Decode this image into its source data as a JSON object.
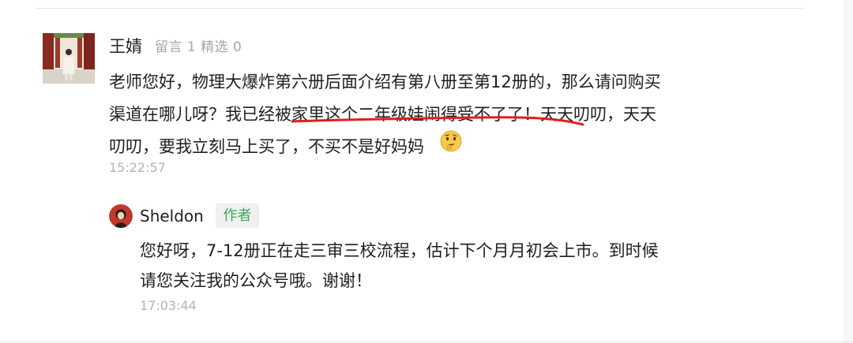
{
  "comment": {
    "username": "王婧",
    "stats": "留言 1 精选 0",
    "text_lines": [
      "老师您好，物理大爆炸第六册后面介绍有第八册至第12册的，那么请问购买",
      "渠道在哪儿呀？我已经被家里这个二年级娃闹得受不了了！天天叨叨，天天",
      "叨叨，要我立刻马上买了，不买不是好妈妈"
    ],
    "emoji": "thinking-face-emoji",
    "time": "15:22:57",
    "annotation_color": "#e02020"
  },
  "reply": {
    "username": "Sheldon",
    "badge": "作者",
    "badge_color": "#3aaa5a",
    "text_lines": [
      "您好呀，7-12册正在走三审三校流程，估计下个月月初会上市。到时候",
      "请您关注我的公众号哦。谢谢！"
    ],
    "time": "17:03:44"
  }
}
